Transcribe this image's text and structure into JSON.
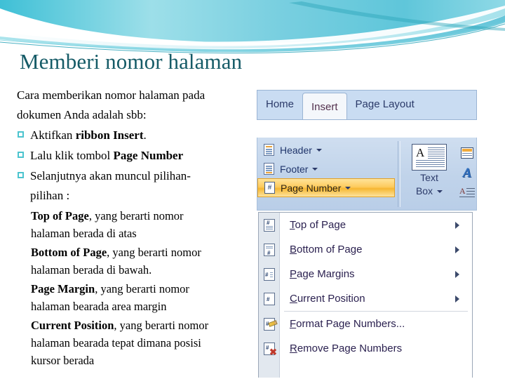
{
  "slide": {
    "title": "Memberi nomor halaman",
    "title_color": "#155b67",
    "accent_color": "#4cc4cf",
    "intro_lines": [
      "Cara memberikan nomor halaman pada",
      "dokumen Anda adalah sbb:"
    ],
    "bullets": [
      {
        "plain": "Aktifkan ",
        "bold": "ribbon Insert",
        "tail": "."
      },
      {
        "plain": "Lalu klik tombol ",
        "bold": "Page Number",
        "tail": ""
      },
      {
        "plain": "Selanjutnya akan muncul pilihan-",
        "bold": "",
        "tail": ""
      }
    ],
    "bullet_continuation": "pilihan :",
    "sub_items": [
      {
        "term": "Top of Page",
        "rest": ", yang berarti nomor",
        "line2": "halaman berada di atas"
      },
      {
        "term": "Bottom of Page",
        "rest": ",  yang berarti nomor",
        "line2": "halaman berada di bawah."
      },
      {
        "term": "Page Margin",
        "rest": ", yang berarti nomor",
        "line2": "halaman bearada area margin"
      },
      {
        "term": "Current Position",
        "rest": ", yang berarti nomor",
        "line2": "halaman bearada tepat dimana posisi",
        "line3": "kursor berada"
      }
    ]
  },
  "ribbon": {
    "tabs": [
      {
        "label": "Home",
        "active": false
      },
      {
        "label": "Insert",
        "active": true
      },
      {
        "label": "Page Layout",
        "active": false
      }
    ],
    "header_footer_group": [
      {
        "label": "Header",
        "icon": "header-icon",
        "highlighted": false
      },
      {
        "label": "Footer",
        "icon": "footer-icon",
        "highlighted": false
      },
      {
        "label": "Page Number",
        "icon": "page-number-icon",
        "highlighted": true
      }
    ],
    "highlight_color": "#f6b733",
    "text_box": {
      "line1": "Text",
      "line2": "Box",
      "icon": "text-box-icon"
    },
    "side_icons": [
      {
        "name": "quick-parts-icon"
      },
      {
        "name": "word-art-icon",
        "glyph": "A"
      },
      {
        "name": "drop-cap-icon",
        "glyph": "A"
      }
    ]
  },
  "page_number_menu": {
    "items": [
      {
        "label": "Top of Page",
        "accel": "T",
        "icon": "page-number-top-icon",
        "submenu": true
      },
      {
        "label": "Bottom of Page",
        "accel": "B",
        "icon": "page-number-bottom-icon",
        "submenu": true
      },
      {
        "label": "Page Margins",
        "accel": "P",
        "icon": "page-margins-icon",
        "submenu": true
      },
      {
        "label": "Current Position",
        "accel": "C",
        "icon": "current-position-icon",
        "submenu": true
      },
      {
        "label": "Format Page Numbers...",
        "accel": "F",
        "icon": "format-page-numbers-icon",
        "submenu": false
      },
      {
        "label": "Remove Page Numbers",
        "accel": "R",
        "icon": "remove-page-numbers-icon",
        "submenu": false
      }
    ],
    "separator_after_index": 3
  }
}
